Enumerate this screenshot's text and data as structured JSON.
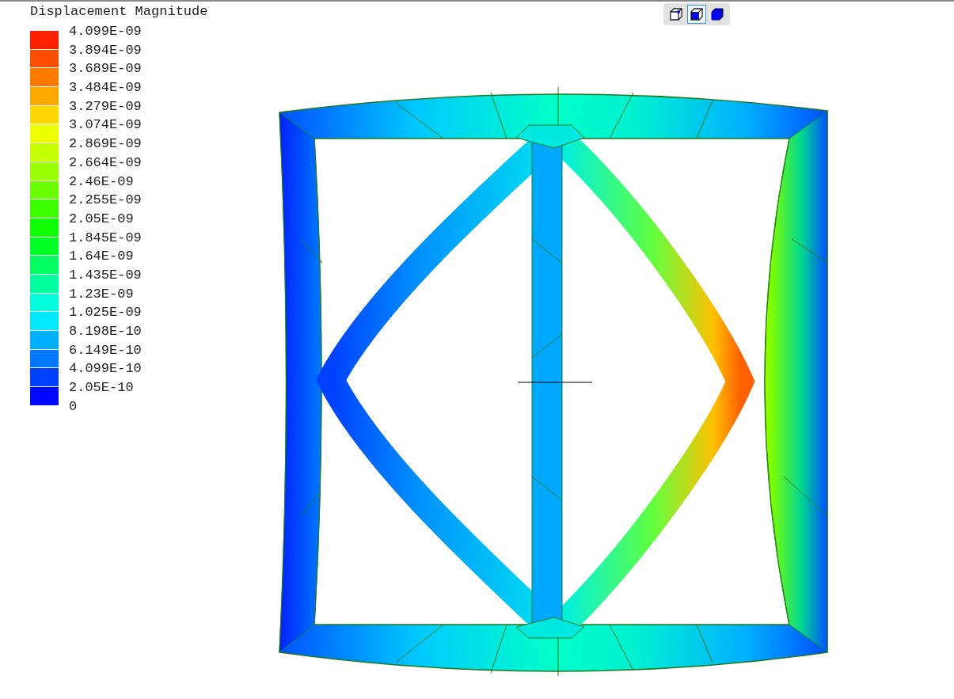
{
  "legend": {
    "title": "Displacement Magnitude",
    "swatches": [
      {
        "color": "#ff2000"
      },
      {
        "color": "#ff4d00"
      },
      {
        "color": "#ff7a00"
      },
      {
        "color": "#ffa800"
      },
      {
        "color": "#ffd700"
      },
      {
        "color": "#f0ff00"
      },
      {
        "color": "#c4ff00"
      },
      {
        "color": "#97ff00"
      },
      {
        "color": "#6aff00"
      },
      {
        "color": "#3dff00"
      },
      {
        "color": "#10ff00"
      },
      {
        "color": "#00ff22"
      },
      {
        "color": "#00ff60"
      },
      {
        "color": "#00ff9d"
      },
      {
        "color": "#00ffda"
      },
      {
        "color": "#00e8ff"
      },
      {
        "color": "#00b0ff"
      },
      {
        "color": "#0078ff"
      },
      {
        "color": "#0040ff"
      },
      {
        "color": "#0008ff"
      }
    ],
    "labels": [
      "4.099E-09",
      "3.894E-09",
      "3.689E-09",
      "3.484E-09",
      "3.279E-09",
      "3.074E-09",
      "2.869E-09",
      "2.664E-09",
      "2.46E-09",
      "2.255E-09",
      "2.05E-09",
      "1.845E-09",
      "1.64E-09",
      "1.435E-09",
      "1.23E-09",
      "1.025E-09",
      "8.198E-10",
      "6.149E-10",
      "4.099E-10",
      "2.05E-10",
      "0"
    ]
  },
  "view_toolbar": {
    "buttons": [
      {
        "kind": "wireframe",
        "selected": false
      },
      {
        "kind": "shaded_edges",
        "selected": true
      },
      {
        "kind": "solid",
        "selected": false
      }
    ]
  }
}
